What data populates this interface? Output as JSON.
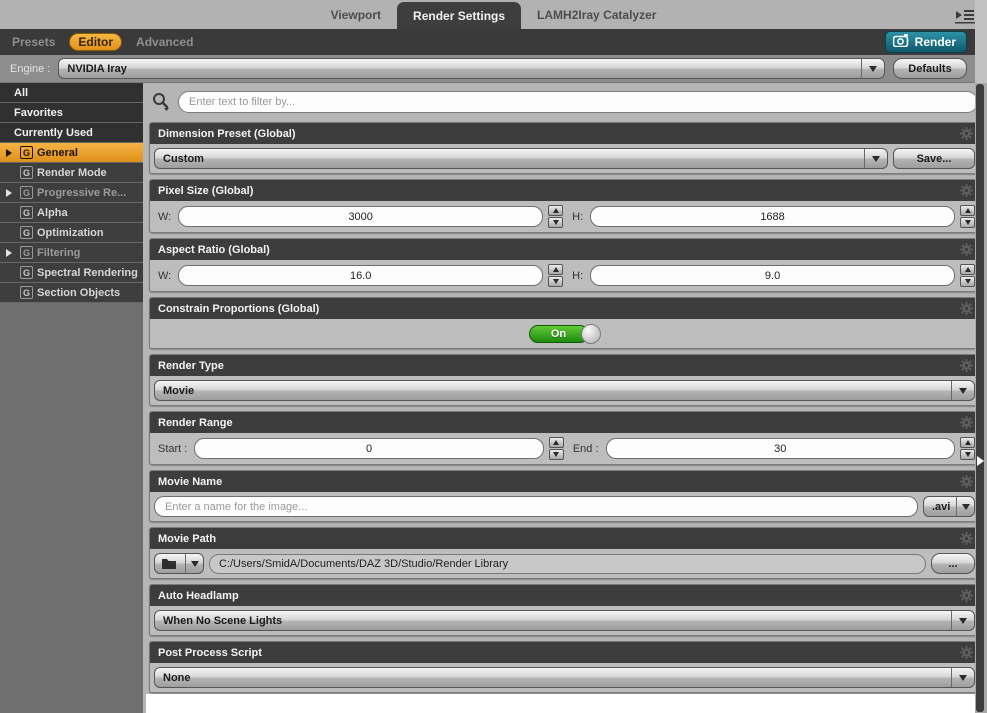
{
  "tabs": {
    "viewport": "Viewport",
    "render_settings": "Render Settings",
    "lamh": "LAMH2Iray Catalyzer"
  },
  "subtabs": {
    "presets": "Presets",
    "editor": "Editor",
    "advanced": "Advanced",
    "render_button": "Render"
  },
  "engine": {
    "label": "Engine :",
    "value": "NVIDIA Iray",
    "defaults_button": "Defaults"
  },
  "sidebar": {
    "categories": [
      "All",
      "Favorites",
      "Currently Used"
    ],
    "items": [
      {
        "icon": "G",
        "label": "General"
      },
      {
        "icon": "G",
        "label": "Render Mode"
      },
      {
        "icon": "G",
        "label": "Progressive Re..."
      },
      {
        "icon": "G",
        "label": "Alpha"
      },
      {
        "icon": "G",
        "label": "Optimization"
      },
      {
        "icon": "G",
        "label": "Filtering"
      },
      {
        "icon": "G",
        "label": "Spectral Rendering"
      },
      {
        "icon": "G",
        "label": "Section Objects"
      }
    ]
  },
  "filter": {
    "placeholder": "Enter text to filter by..."
  },
  "sections": {
    "dimension_preset": {
      "title": "Dimension Preset (Global)",
      "value": "Custom",
      "save_button": "Save..."
    },
    "pixel_size": {
      "title": "Pixel Size (Global)",
      "w_label": "W:",
      "w_value": "3000",
      "h_label": "H:",
      "h_value": "1688"
    },
    "aspect_ratio": {
      "title": "Aspect Ratio (Global)",
      "w_label": "W:",
      "w_value": "16.0",
      "h_label": "H:",
      "h_value": "9.0"
    },
    "constrain_proportions": {
      "title": "Constrain Proportions (Global)",
      "toggle_state": "On"
    },
    "render_type": {
      "title": "Render Type",
      "value": "Movie"
    },
    "render_range": {
      "title": "Render Range",
      "start_label": "Start :",
      "start_value": "0",
      "end_label": "End :",
      "end_value": "30"
    },
    "movie_name": {
      "title": "Movie Name",
      "placeholder": "Enter a name for the image...",
      "extension": ".avi"
    },
    "movie_path": {
      "title": "Movie Path",
      "value": "C:/Users/SmidA/Documents/DAZ 3D/Studio/Render Library",
      "browse_button": "..."
    },
    "auto_headlamp": {
      "title": "Auto Headlamp",
      "value": "When No Scene Lights"
    },
    "post_process_script": {
      "title": "Post Process Script",
      "value": "None"
    }
  },
  "colors": {
    "accent_orange": "#e8a32e",
    "render_teal": "#16606f",
    "toggle_green": "#2da01c",
    "header_dark": "#3d3d3d"
  }
}
